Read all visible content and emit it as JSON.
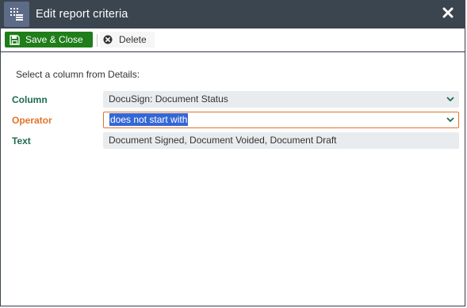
{
  "dialog": {
    "title": "Edit report criteria",
    "icon": "report-filter-icon",
    "close_icon": "close-icon"
  },
  "toolbar": {
    "save_label": "Save & Close",
    "delete_label": "Delete"
  },
  "form": {
    "instruction": "Select a column from Details:",
    "column": {
      "label": "Column",
      "value": "DocuSign: Document Status"
    },
    "operator": {
      "label": "Operator",
      "value": "does not start with"
    },
    "text": {
      "label": "Text",
      "value": "Document Signed, Document Voided, Document Draft"
    }
  },
  "colors": {
    "titlebar": "#3a4550",
    "save_button": "#1f7d1a",
    "label_green": "#1e6b4e",
    "label_orange": "#e0742a",
    "field_bg": "#e9ecef",
    "selection": "#3367d6"
  }
}
